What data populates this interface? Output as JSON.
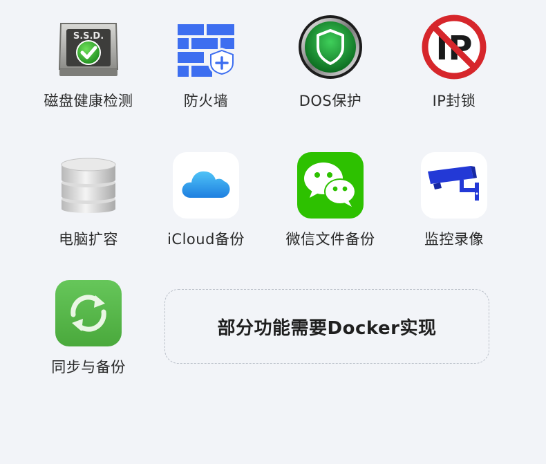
{
  "features": [
    {
      "label": "磁盘健康检测",
      "icon": "ssd-health-icon"
    },
    {
      "label": "防火墙",
      "icon": "firewall-icon"
    },
    {
      "label": "DOS保护",
      "icon": "shield-icon"
    },
    {
      "label": "IP封锁",
      "icon": "ip-block-icon"
    },
    {
      "label": "电脑扩容",
      "icon": "database-icon"
    },
    {
      "label": "iCloud备份",
      "icon": "cloud-icon"
    },
    {
      "label": "微信文件备份",
      "icon": "wechat-icon"
    },
    {
      "label": "监控录像",
      "icon": "camera-icon"
    },
    {
      "label": "同步与备份",
      "icon": "sync-icon"
    }
  ],
  "docker_note": "部分功能需要Docker实现",
  "ssd_icon_text": "S.S.D.",
  "ip_icon_text": "IP",
  "colors": {
    "background": "#f2f4f8",
    "firewall_blue": "#3d6ef0",
    "shield_green": "#1e9c3a",
    "block_red": "#d6262b",
    "icloud_blue": "#2a9df4",
    "wechat_green": "#2dc100",
    "camera_blue": "#2339d6",
    "sync_green": "#5ab84a"
  }
}
